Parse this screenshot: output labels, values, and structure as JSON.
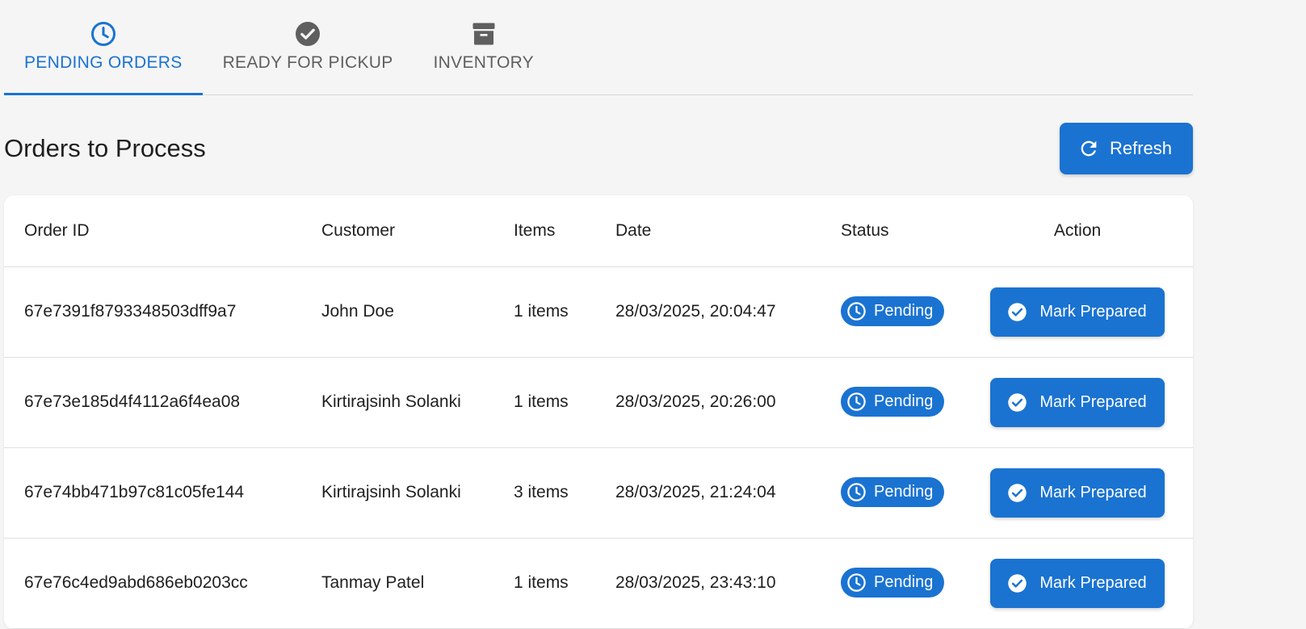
{
  "tabs": [
    {
      "label": "PENDING ORDERS",
      "icon": "clock-icon",
      "active": true
    },
    {
      "label": "READY FOR PICKUP",
      "icon": "check-circle-icon",
      "active": false
    },
    {
      "label": "INVENTORY",
      "icon": "archive-box-icon",
      "active": false
    }
  ],
  "header": {
    "title": "Orders to Process",
    "refresh_label": "Refresh",
    "refresh_icon": "refresh-icon"
  },
  "table": {
    "columns": {
      "order_id": "Order ID",
      "customer": "Customer",
      "items": "Items",
      "date": "Date",
      "status": "Status",
      "action": "Action"
    },
    "rows": [
      {
        "order_id": "67e7391f8793348503dff9a7",
        "customer": "John Doe",
        "items": "1 items",
        "date": "28/03/2025, 20:04:47",
        "status": "Pending",
        "action": "Mark Prepared"
      },
      {
        "order_id": "67e73e185d4f4112a6f4ea08",
        "customer": "Kirtirajsinh Solanki",
        "items": "1 items",
        "date": "28/03/2025, 20:26:00",
        "status": "Pending",
        "action": "Mark Prepared"
      },
      {
        "order_id": "67e74bb471b97c81c05fe144",
        "customer": "Kirtirajsinh Solanki",
        "items": "3 items",
        "date": "28/03/2025, 21:24:04",
        "status": "Pending",
        "action": "Mark Prepared"
      },
      {
        "order_id": "67e76c4ed9abd686eb0203cc",
        "customer": "Tanmay Patel",
        "items": "1 items",
        "date": "28/03/2025, 23:43:10",
        "status": "Pending",
        "action": "Mark Prepared"
      }
    ]
  },
  "colors": {
    "accent": "#1a73d1",
    "background": "#f5f5f5",
    "inactive_tab": "#5f5f5f"
  }
}
